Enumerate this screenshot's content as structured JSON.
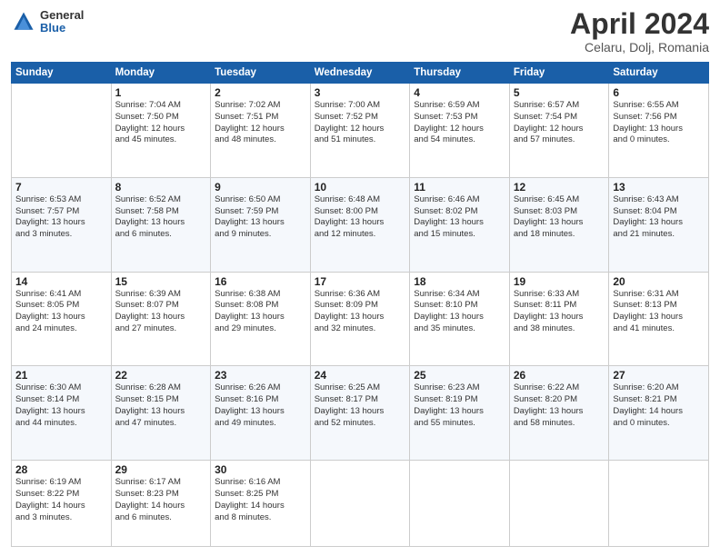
{
  "logo": {
    "general": "General",
    "blue": "Blue"
  },
  "header": {
    "title": "April 2024",
    "subtitle": "Celaru, Dolj, Romania"
  },
  "weekdays": [
    "Sunday",
    "Monday",
    "Tuesday",
    "Wednesday",
    "Thursday",
    "Friday",
    "Saturday"
  ],
  "weeks": [
    [
      {
        "day": "",
        "info": ""
      },
      {
        "day": "1",
        "info": "Sunrise: 7:04 AM\nSunset: 7:50 PM\nDaylight: 12 hours\nand 45 minutes."
      },
      {
        "day": "2",
        "info": "Sunrise: 7:02 AM\nSunset: 7:51 PM\nDaylight: 12 hours\nand 48 minutes."
      },
      {
        "day": "3",
        "info": "Sunrise: 7:00 AM\nSunset: 7:52 PM\nDaylight: 12 hours\nand 51 minutes."
      },
      {
        "day": "4",
        "info": "Sunrise: 6:59 AM\nSunset: 7:53 PM\nDaylight: 12 hours\nand 54 minutes."
      },
      {
        "day": "5",
        "info": "Sunrise: 6:57 AM\nSunset: 7:54 PM\nDaylight: 12 hours\nand 57 minutes."
      },
      {
        "day": "6",
        "info": "Sunrise: 6:55 AM\nSunset: 7:56 PM\nDaylight: 13 hours\nand 0 minutes."
      }
    ],
    [
      {
        "day": "7",
        "info": "Sunrise: 6:53 AM\nSunset: 7:57 PM\nDaylight: 13 hours\nand 3 minutes."
      },
      {
        "day": "8",
        "info": "Sunrise: 6:52 AM\nSunset: 7:58 PM\nDaylight: 13 hours\nand 6 minutes."
      },
      {
        "day": "9",
        "info": "Sunrise: 6:50 AM\nSunset: 7:59 PM\nDaylight: 13 hours\nand 9 minutes."
      },
      {
        "day": "10",
        "info": "Sunrise: 6:48 AM\nSunset: 8:00 PM\nDaylight: 13 hours\nand 12 minutes."
      },
      {
        "day": "11",
        "info": "Sunrise: 6:46 AM\nSunset: 8:02 PM\nDaylight: 13 hours\nand 15 minutes."
      },
      {
        "day": "12",
        "info": "Sunrise: 6:45 AM\nSunset: 8:03 PM\nDaylight: 13 hours\nand 18 minutes."
      },
      {
        "day": "13",
        "info": "Sunrise: 6:43 AM\nSunset: 8:04 PM\nDaylight: 13 hours\nand 21 minutes."
      }
    ],
    [
      {
        "day": "14",
        "info": "Sunrise: 6:41 AM\nSunset: 8:05 PM\nDaylight: 13 hours\nand 24 minutes."
      },
      {
        "day": "15",
        "info": "Sunrise: 6:39 AM\nSunset: 8:07 PM\nDaylight: 13 hours\nand 27 minutes."
      },
      {
        "day": "16",
        "info": "Sunrise: 6:38 AM\nSunset: 8:08 PM\nDaylight: 13 hours\nand 29 minutes."
      },
      {
        "day": "17",
        "info": "Sunrise: 6:36 AM\nSunset: 8:09 PM\nDaylight: 13 hours\nand 32 minutes."
      },
      {
        "day": "18",
        "info": "Sunrise: 6:34 AM\nSunset: 8:10 PM\nDaylight: 13 hours\nand 35 minutes."
      },
      {
        "day": "19",
        "info": "Sunrise: 6:33 AM\nSunset: 8:11 PM\nDaylight: 13 hours\nand 38 minutes."
      },
      {
        "day": "20",
        "info": "Sunrise: 6:31 AM\nSunset: 8:13 PM\nDaylight: 13 hours\nand 41 minutes."
      }
    ],
    [
      {
        "day": "21",
        "info": "Sunrise: 6:30 AM\nSunset: 8:14 PM\nDaylight: 13 hours\nand 44 minutes."
      },
      {
        "day": "22",
        "info": "Sunrise: 6:28 AM\nSunset: 8:15 PM\nDaylight: 13 hours\nand 47 minutes."
      },
      {
        "day": "23",
        "info": "Sunrise: 6:26 AM\nSunset: 8:16 PM\nDaylight: 13 hours\nand 49 minutes."
      },
      {
        "day": "24",
        "info": "Sunrise: 6:25 AM\nSunset: 8:17 PM\nDaylight: 13 hours\nand 52 minutes."
      },
      {
        "day": "25",
        "info": "Sunrise: 6:23 AM\nSunset: 8:19 PM\nDaylight: 13 hours\nand 55 minutes."
      },
      {
        "day": "26",
        "info": "Sunrise: 6:22 AM\nSunset: 8:20 PM\nDaylight: 13 hours\nand 58 minutes."
      },
      {
        "day": "27",
        "info": "Sunrise: 6:20 AM\nSunset: 8:21 PM\nDaylight: 14 hours\nand 0 minutes."
      }
    ],
    [
      {
        "day": "28",
        "info": "Sunrise: 6:19 AM\nSunset: 8:22 PM\nDaylight: 14 hours\nand 3 minutes."
      },
      {
        "day": "29",
        "info": "Sunrise: 6:17 AM\nSunset: 8:23 PM\nDaylight: 14 hours\nand 6 minutes."
      },
      {
        "day": "30",
        "info": "Sunrise: 6:16 AM\nSunset: 8:25 PM\nDaylight: 14 hours\nand 8 minutes."
      },
      {
        "day": "",
        "info": ""
      },
      {
        "day": "",
        "info": ""
      },
      {
        "day": "",
        "info": ""
      },
      {
        "day": "",
        "info": ""
      }
    ]
  ]
}
